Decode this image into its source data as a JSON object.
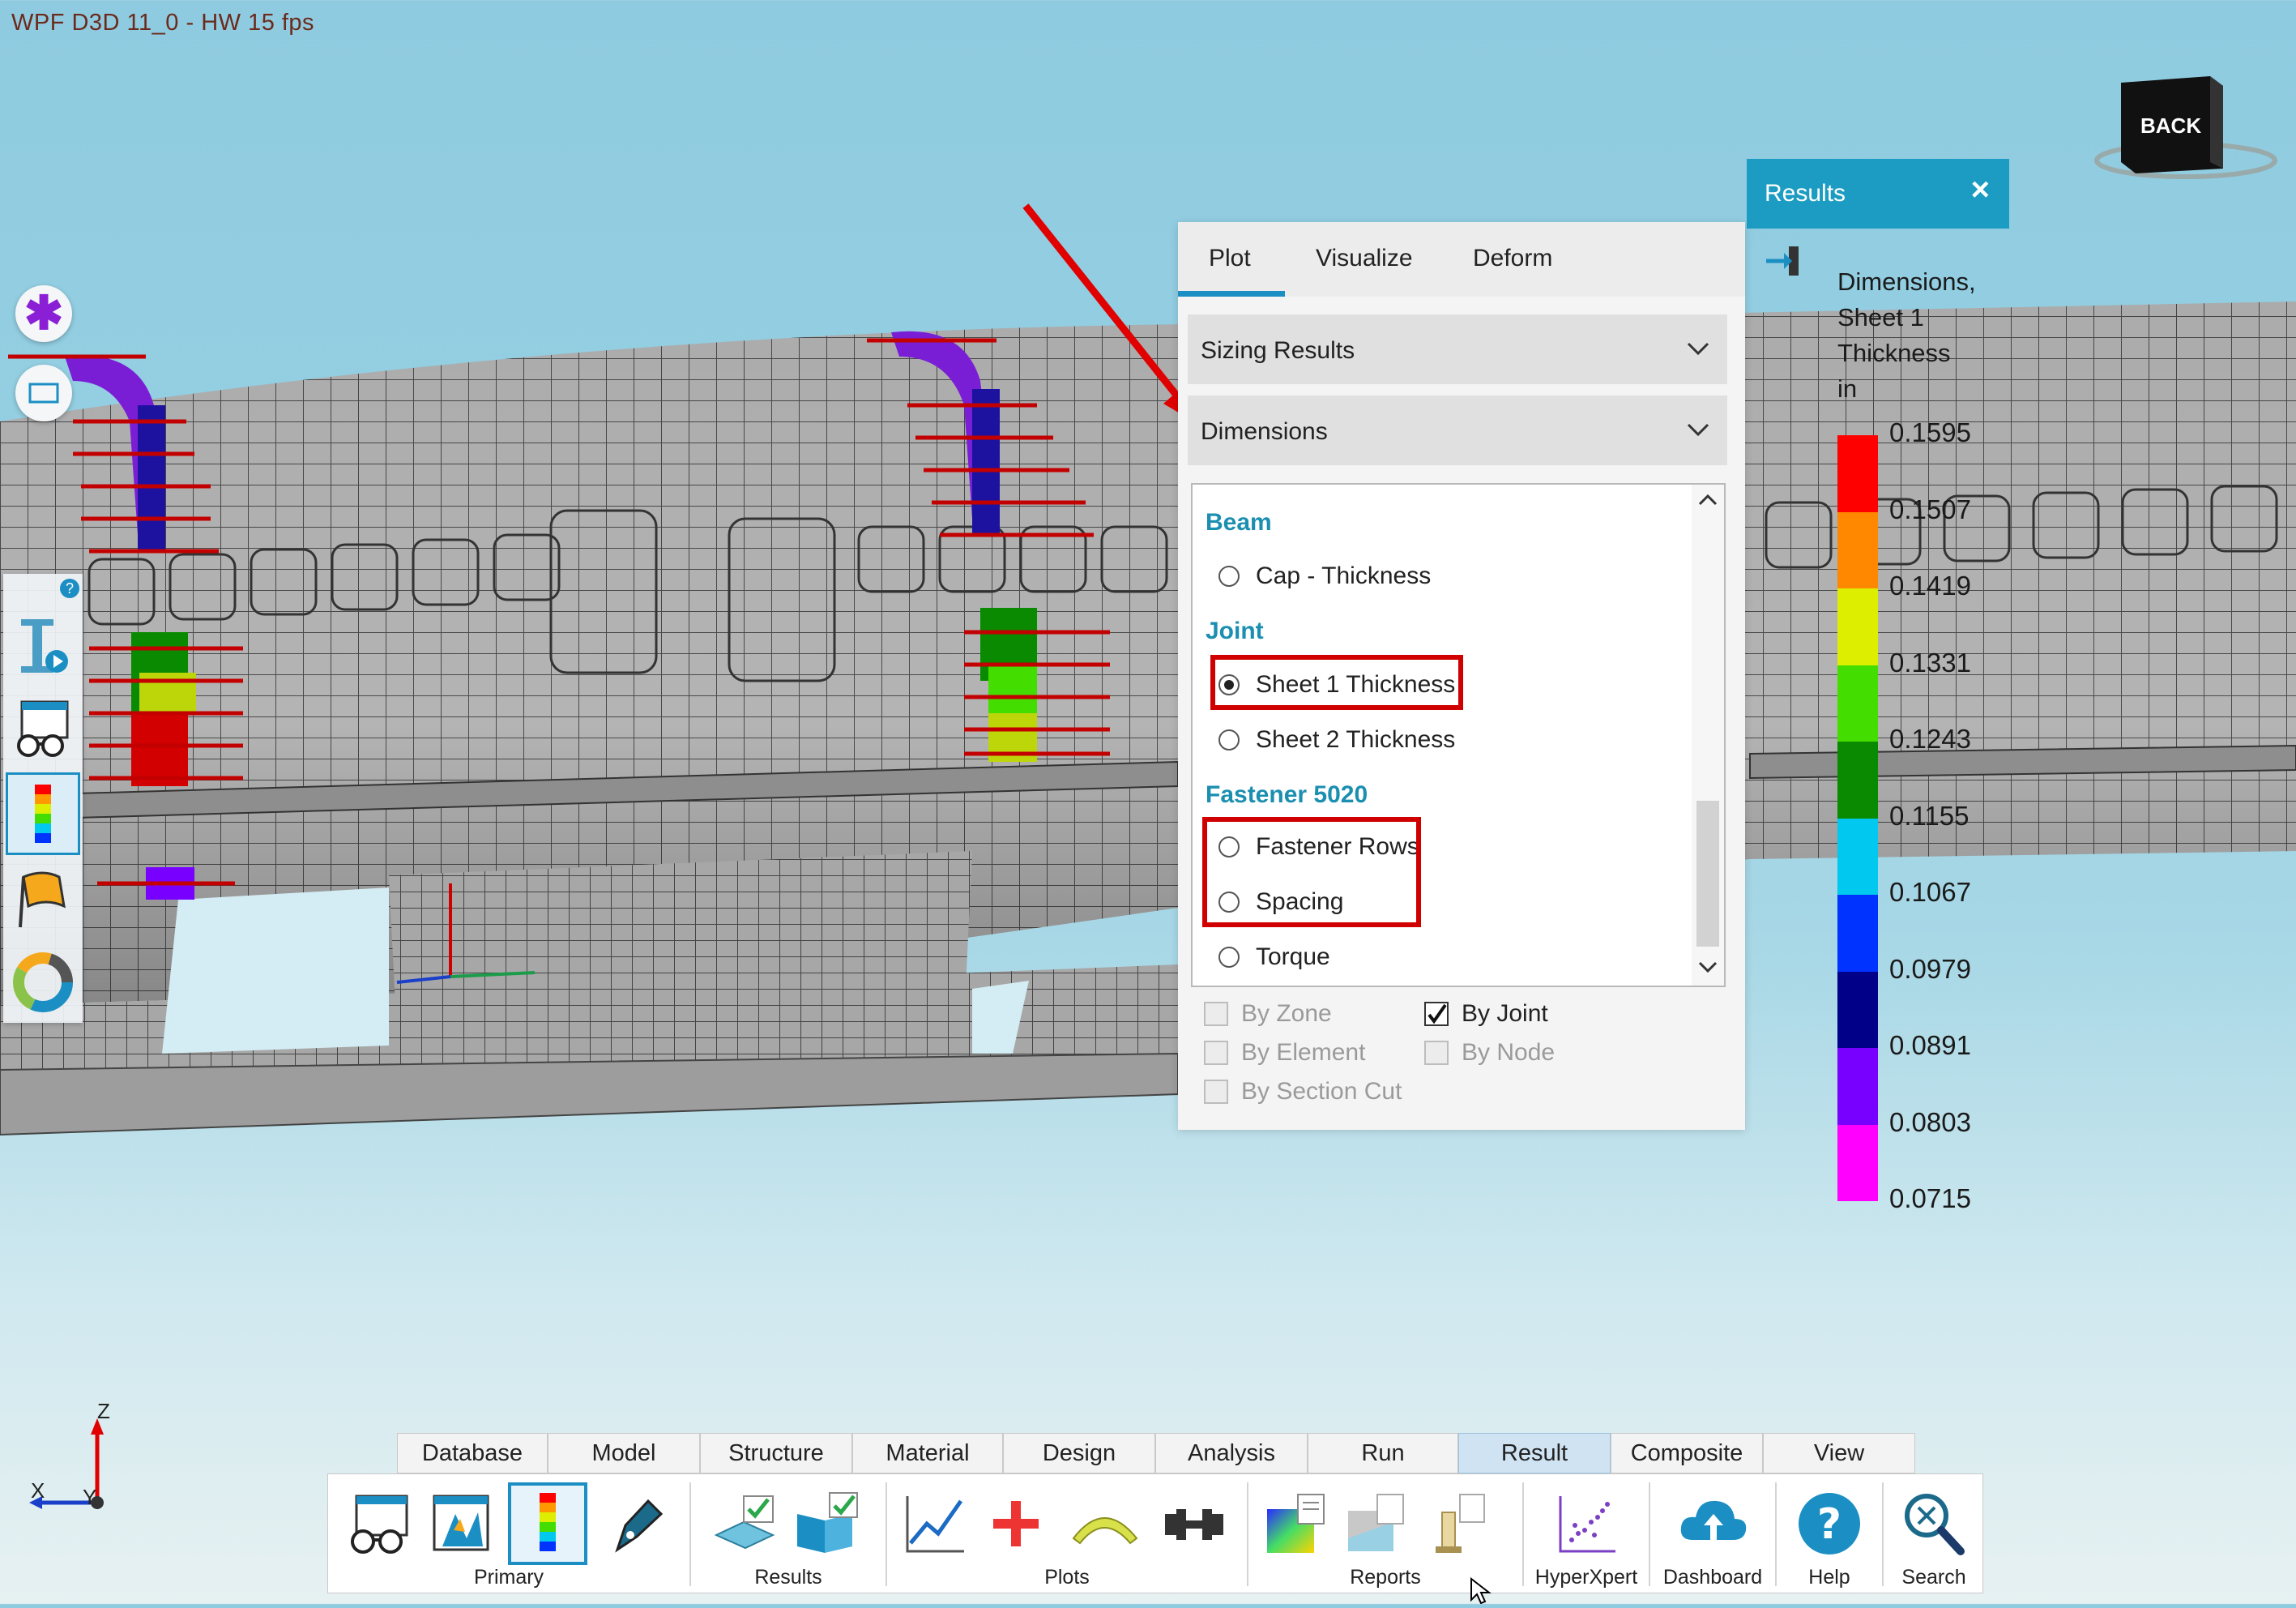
{
  "app": {
    "title": "WPF D3D 11_0 - HW  15  fps"
  },
  "viewcube": {
    "label": "BACK"
  },
  "plot_panel": {
    "tabs": [
      "Plot",
      "Visualize",
      "Deform"
    ],
    "active_tab": "Plot",
    "accordions": [
      "Sizing Results",
      "Dimensions"
    ],
    "groups": {
      "beam": {
        "label": "Beam",
        "options": [
          "Cap - Thickness"
        ]
      },
      "joint": {
        "label": "Joint",
        "options": [
          "Sheet 1 Thickness",
          "Sheet 2 Thickness"
        ],
        "selected": "Sheet 1 Thickness"
      },
      "fastener": {
        "label": "Fastener 5020",
        "options": [
          "Fastener Rows",
          "Spacing",
          "Torque"
        ]
      }
    },
    "checks": {
      "by_zone": "By Zone",
      "by_joint": "By Joint",
      "by_element": "By Element",
      "by_node": "By Node",
      "by_section_cut": "By Section Cut",
      "checked": [
        "By Joint"
      ]
    }
  },
  "results_panel": {
    "title": "Results",
    "close": "×",
    "legend_title": "Dimensions, Sheet 1 Thickness",
    "legend_unit": "in",
    "legend_values": [
      "0.1595",
      "0.1507",
      "0.1419",
      "0.1331",
      "0.1243",
      "0.1155",
      "0.1067",
      "0.0979",
      "0.0891",
      "0.0803",
      "0.0715"
    ],
    "legend_colors": [
      "#ff0000",
      "#ff8800",
      "#ddee00",
      "#44dd00",
      "#0a8a00",
      "#00c8ee",
      "#0033ff",
      "#000088",
      "#7700ff",
      "#ff00ff"
    ]
  },
  "ribbon": {
    "tabs": [
      "Database",
      "Model",
      "Structure",
      "Material",
      "Design",
      "Analysis",
      "Run",
      "Result",
      "Composite",
      "View"
    ],
    "active_tab": "Result",
    "groups": [
      "Primary",
      "Results",
      "Plots",
      "Reports",
      "HyperXpert",
      "Dashboard",
      "Help",
      "Search"
    ]
  },
  "axis": {
    "z": "Z",
    "x": "X",
    "y": "Y"
  }
}
